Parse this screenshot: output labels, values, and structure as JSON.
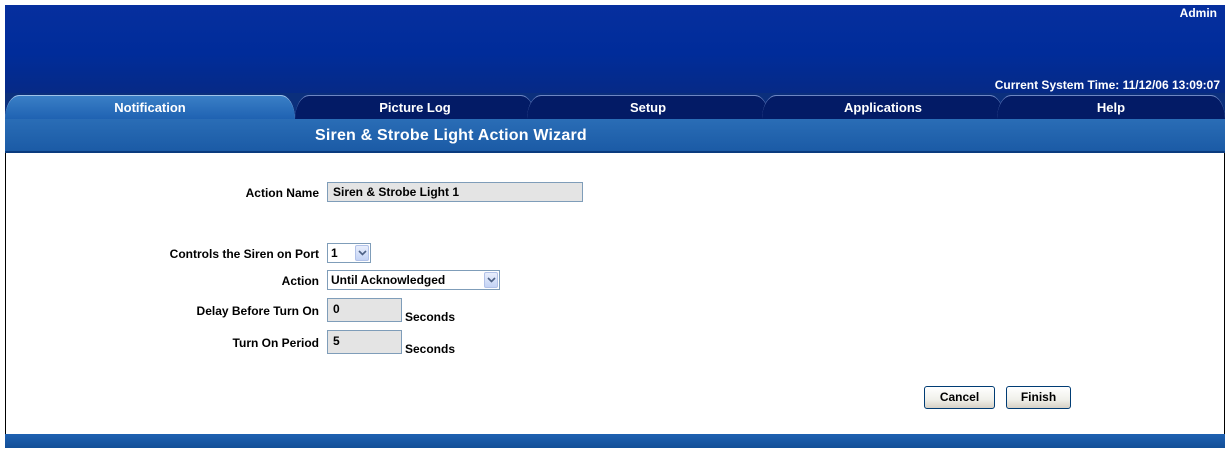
{
  "header": {
    "user": "Admin",
    "system_time": "Current System Time: 11/12/06 13:09:07"
  },
  "tabs": [
    {
      "label": "Notification",
      "active": true
    },
    {
      "label": "Picture Log",
      "active": false
    },
    {
      "label": "Setup",
      "active": false
    },
    {
      "label": "Applications",
      "active": false
    },
    {
      "label": "Help",
      "active": false
    }
  ],
  "wizard": {
    "title": "Siren & Strobe Light Action Wizard"
  },
  "form": {
    "action_name": {
      "label": "Action Name",
      "value": "Siren & Strobe Light 1"
    },
    "port": {
      "label": "Controls the Siren on Port",
      "value": "1"
    },
    "action": {
      "label": "Action",
      "value": "Until Acknowledged"
    },
    "delay": {
      "label": "Delay Before Turn On",
      "value": "0",
      "units": "Seconds"
    },
    "period": {
      "label": "Turn On Period",
      "value": "5",
      "units": "Seconds"
    }
  },
  "buttons": {
    "cancel": "Cancel",
    "finish": "Finish"
  },
  "colors": {
    "header_blue": "#002c9a",
    "tab_dark": "#031b66",
    "tab_active": "#2a6db6",
    "bar_blue": "#1f62b2"
  }
}
